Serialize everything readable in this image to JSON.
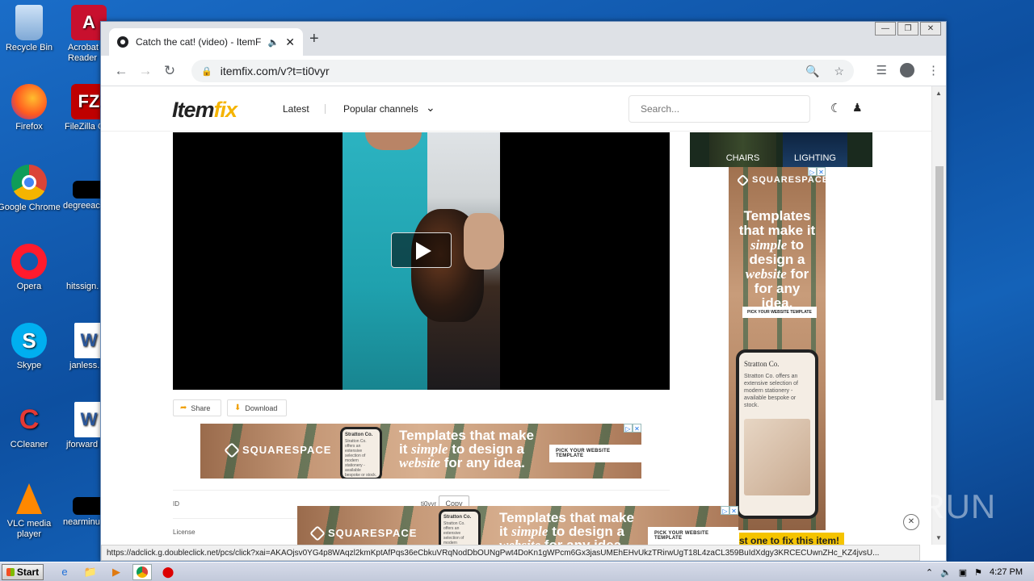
{
  "desktop": {
    "icons": [
      {
        "label": "Recycle Bin",
        "icon": "recycle-bin-icon"
      },
      {
        "label": "Acrobat Reader",
        "icon": "acrobat-icon"
      },
      {
        "label": "Firefox",
        "icon": "firefox-icon"
      },
      {
        "label": "FileZilla C",
        "icon": "filezilla-icon"
      },
      {
        "label": "Google Chrome",
        "icon": "chrome-icon"
      },
      {
        "label": "degreeac",
        "icon": "file-icon"
      },
      {
        "label": "Opera",
        "icon": "opera-icon"
      },
      {
        "label": "hitssign.",
        "icon": "file-icon"
      },
      {
        "label": "Skype",
        "icon": "skype-icon"
      },
      {
        "label": "janless.",
        "icon": "word-icon"
      },
      {
        "label": "CCleaner",
        "icon": "ccleaner-icon"
      },
      {
        "label": "jforward",
        "icon": "word-icon"
      },
      {
        "label": "VLC media player",
        "icon": "vlc-icon"
      },
      {
        "label": "nearminu",
        "icon": "file-icon"
      }
    ]
  },
  "browser": {
    "tab_title": "Catch the cat! (video) - ItemFix",
    "url": "itemfix.com/v?t=ti0vyr",
    "status_url": "https://adclick.g.doubleclick.net/pcs/click?xai=AKAOjsv0YG4p8WAqzl2kmKptAfPqs36eCbkuVRqNodDbOUNgPwt4DoKn1gWPcm6Gx3jasUMEhEHvUkzTRirwUgT18L4zaCL359BuIdXdgy3KRCECUwnZHc_KZ4jvsU..."
  },
  "site": {
    "logo_main": "Item",
    "logo_accent": "fix",
    "nav": [
      "Latest",
      "Popular channels"
    ],
    "search_placeholder": "Search...",
    "share_label": "Share",
    "download_label": "Download",
    "meta_id_label": "ID",
    "meta_id_value": "ti0vyr",
    "copy_label": "Copy",
    "meta_license_label": "License",
    "thumbs": [
      "CHAIRS",
      "LIGHTING"
    ],
    "notice": "st one to fix this item!"
  },
  "ads": {
    "brand": "SQUARESPACE",
    "headline_pre": "Templates that make it",
    "headline_em1": "simple",
    "headline_mid": "to design a",
    "headline_em2": "website",
    "headline_post": "for any idea.",
    "v_l1": "Templates",
    "v_l2": "that make it",
    "v_l4": "to",
    "v_l5": "design a",
    "v_l7": "for",
    "cta": "PICK YOUR WEBSITE TEMPLATE",
    "phone_title": "Stratton Co.",
    "phone_text": "Stratton Co. offers an extensive selection of modern stationery - available bespoke or stock."
  },
  "watermark": "ANY RUN",
  "taskbar": {
    "start_label": "Start",
    "time": "4:27 PM"
  }
}
